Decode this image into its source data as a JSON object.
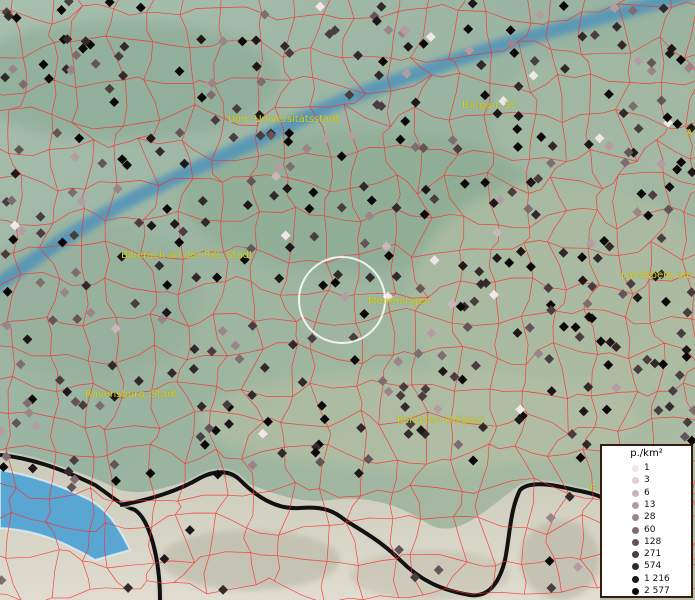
{
  "map": {
    "places": [
      {
        "name": "Ulm, Universitätsstadt"
      },
      {
        "name": "Burgau, St"
      },
      {
        "name": "A"
      },
      {
        "name": "Biberach an der Riß, Stadt"
      },
      {
        "name": "Memmingen"
      },
      {
        "name": "Landsberg am"
      },
      {
        "name": "Ravensburg, Stadt"
      },
      {
        "name": "Kempten (Allgäu)"
      },
      {
        "name": "F"
      }
    ],
    "legend": {
      "title": "p./km²",
      "classes": [
        {
          "label": "1",
          "color": "#f2e6e8"
        },
        {
          "label": "3",
          "color": "#e0cfd2"
        },
        {
          "label": "6",
          "color": "#cbb6ba"
        },
        {
          "label": "13",
          "color": "#b49da2"
        },
        {
          "label": "28",
          "color": "#9b858a"
        },
        {
          "label": "60",
          "color": "#7f6c70"
        },
        {
          "label": "128",
          "color": "#645457"
        },
        {
          "label": "271",
          "color": "#4a3d40"
        },
        {
          "label": "574",
          "color": "#33292b"
        },
        {
          "label": "1 216",
          "color": "#1f1718"
        },
        {
          "label": "2 577",
          "color": "#0c0809"
        }
      ]
    },
    "colors": {
      "terrain": "#9fb7a6",
      "water": "#4f93b8",
      "borders": "#ff2a2a",
      "label": "#d8d020",
      "highlight_ring": "#ffffff",
      "national_border": "#111111"
    }
  }
}
